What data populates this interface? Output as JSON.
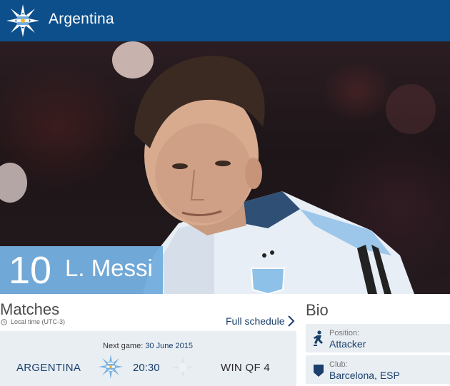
{
  "header": {
    "team_name": "Argentina",
    "brand_color": "#0d4f8b",
    "logo_icon": "argentina-sun-star-icon"
  },
  "player": {
    "number": "10",
    "name": "L. Messi",
    "panel_color": "#74aedf"
  },
  "matches": {
    "title": "Matches",
    "local_time": "Local time (UTC-3)",
    "full_schedule_label": "Full schedule",
    "next_game_label": "Next game:",
    "next_game_date": "30 June 2015",
    "home_team": "ARGENTINA",
    "kickoff_time": "20:30",
    "away_team": "WIN QF 4"
  },
  "bio": {
    "title": "Bio",
    "items": [
      {
        "label": "Position:",
        "value": "Attacker",
        "icon": "player-running-icon"
      },
      {
        "label": "Club:",
        "value": "Barcelona, ESP",
        "icon": "shield-icon"
      }
    ]
  }
}
